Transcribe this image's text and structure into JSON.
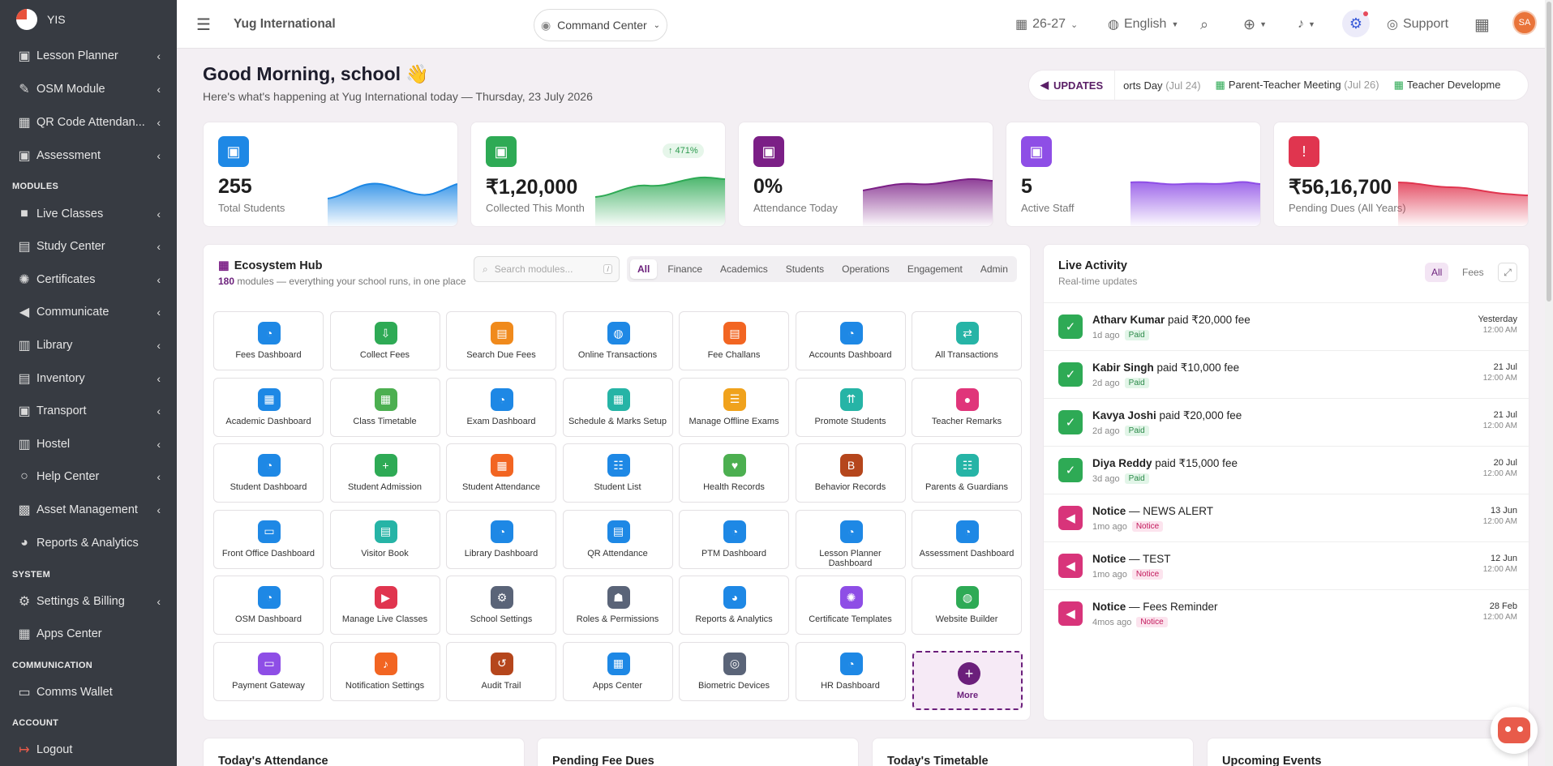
{
  "sidebar": {
    "brand": "YIS",
    "sections": {
      "modules": "MODULES",
      "system": "SYSTEM",
      "communication": "COMMUNICATION",
      "account": "ACCOUNT"
    },
    "items": [
      {
        "label": "Lesson Planner",
        "icon": "clipboard-icon"
      },
      {
        "label": "OSM Module",
        "icon": "pen-icon"
      },
      {
        "label": "QR Code Attendan...",
        "icon": "qr-icon"
      },
      {
        "label": "Assessment",
        "icon": "clipboard-check-icon"
      },
      {
        "label": "Live Classes",
        "icon": "video-icon"
      },
      {
        "label": "Study Center",
        "icon": "book-user-icon"
      },
      {
        "label": "Certificates",
        "icon": "badge-icon"
      },
      {
        "label": "Communicate",
        "icon": "megaphone-icon"
      },
      {
        "label": "Library",
        "icon": "book-icon"
      },
      {
        "label": "Inventory",
        "icon": "warehouse-icon"
      },
      {
        "label": "Transport",
        "icon": "bus-icon"
      },
      {
        "label": "Hostel",
        "icon": "building-icon"
      },
      {
        "label": "Help Center",
        "icon": "help-circle-icon"
      },
      {
        "label": "Asset Management",
        "icon": "cubes-icon"
      },
      {
        "label": "Reports & Analytics",
        "icon": "pie-chart-icon"
      },
      {
        "label": "Settings & Billing",
        "icon": "gears-icon"
      },
      {
        "label": "Apps Center",
        "icon": "grid-icon"
      },
      {
        "label": "Comms Wallet",
        "icon": "wallet-icon"
      },
      {
        "label": "Logout",
        "icon": "logout-icon"
      }
    ]
  },
  "topbar": {
    "school_name": "Yug International",
    "command_center": "Command Center",
    "session": "26-27",
    "language": "English",
    "support": "Support",
    "avatar_initials": "SA"
  },
  "greeting": {
    "title": "Good Morning, school 👋",
    "subtitle": "Here's what's happening at Yug International today — Thursday, 23 July 2026"
  },
  "updates": {
    "label": "UPDATES",
    "items": [
      {
        "text": "orts Day",
        "date": "(Jul 24)"
      },
      {
        "text": "Parent-Teacher Meeting",
        "date": "(Jul 26)"
      },
      {
        "text": "Teacher Developme",
        "date": ""
      }
    ]
  },
  "kpis": [
    {
      "value": "255",
      "label": "Total Students",
      "color": "#1e88e5",
      "icon": "student-icon"
    },
    {
      "value": "₹1,20,000",
      "label": "Collected This Month",
      "color": "#2eaa55",
      "icon": "cash-icon",
      "trend": "↑ 471%"
    },
    {
      "value": "0%",
      "label": "Attendance Today",
      "color": "#7b1f86",
      "icon": "attendance-icon"
    },
    {
      "value": "5",
      "label": "Active Staff",
      "color": "#8e4ee6",
      "icon": "staff-icon"
    },
    {
      "value": "₹56,16,700",
      "label": "Pending Dues (All Years)",
      "color": "#e0354f",
      "icon": "alert-icon"
    }
  ],
  "hub": {
    "title": "Ecosystem Hub",
    "count": "180",
    "subtitle": " modules — everything your school runs, in one place",
    "search_placeholder": "Search modules...",
    "search_key": "/",
    "tabs": [
      "All",
      "Finance",
      "Academics",
      "Students",
      "Operations",
      "Engagement",
      "Admin"
    ],
    "tiles": [
      {
        "label": "Fees Dashboard",
        "color": "#1e88e5",
        "glyph": "◔"
      },
      {
        "label": "Collect Fees",
        "color": "#2eaa55",
        "glyph": "⇩"
      },
      {
        "label": "Search Due Fees",
        "color": "#f08a1c",
        "glyph": "▤"
      },
      {
        "label": "Online Transactions",
        "color": "#1e88e5",
        "glyph": "◍"
      },
      {
        "label": "Fee Challans",
        "color": "#f26522",
        "glyph": "▤"
      },
      {
        "label": "Accounts Dashboard",
        "color": "#1e88e5",
        "glyph": "◔"
      },
      {
        "label": "All Transactions",
        "color": "#26b4a6",
        "glyph": "⇄"
      },
      {
        "label": "Academic Dashboard",
        "color": "#1e88e5",
        "glyph": "▦"
      },
      {
        "label": "Class Timetable",
        "color": "#4caf50",
        "glyph": "▦"
      },
      {
        "label": "Exam Dashboard",
        "color": "#1e88e5",
        "glyph": "◔"
      },
      {
        "label": "Schedule & Marks Setup",
        "color": "#26b4a6",
        "glyph": "▦"
      },
      {
        "label": "Manage Offline Exams",
        "color": "#f0a21c",
        "glyph": "☰"
      },
      {
        "label": "Promote Students",
        "color": "#26b4a6",
        "glyph": "⇈"
      },
      {
        "label": "Teacher Remarks",
        "color": "#e0357a",
        "glyph": "●"
      },
      {
        "label": "Student Dashboard",
        "color": "#1e88e5",
        "glyph": "◔"
      },
      {
        "label": "Student Admission",
        "color": "#2eaa55",
        "glyph": "+"
      },
      {
        "label": "Student Attendance",
        "color": "#f26522",
        "glyph": "▦"
      },
      {
        "label": "Student List",
        "color": "#1e88e5",
        "glyph": "☷"
      },
      {
        "label": "Health Records",
        "color": "#4caf50",
        "glyph": "♥"
      },
      {
        "label": "Behavior Records",
        "color": "#b5461c",
        "glyph": "B"
      },
      {
        "label": "Parents & Guardians",
        "color": "#26b4a6",
        "glyph": "☷"
      },
      {
        "label": "Front Office Dashboard",
        "color": "#1e88e5",
        "glyph": "▭"
      },
      {
        "label": "Visitor Book",
        "color": "#26b4a6",
        "glyph": "▤"
      },
      {
        "label": "Library Dashboard",
        "color": "#1e88e5",
        "glyph": "◔"
      },
      {
        "label": "QR Attendance",
        "color": "#1e88e5",
        "glyph": "▤"
      },
      {
        "label": "PTM Dashboard",
        "color": "#1e88e5",
        "glyph": "◔"
      },
      {
        "label": "Lesson Planner Dashboard",
        "color": "#1e88e5",
        "glyph": "◔"
      },
      {
        "label": "Assessment Dashboard",
        "color": "#1e88e5",
        "glyph": "◔"
      },
      {
        "label": "OSM Dashboard",
        "color": "#1e88e5",
        "glyph": "◔"
      },
      {
        "label": "Manage Live Classes",
        "color": "#e0354f",
        "glyph": "▶"
      },
      {
        "label": "School Settings",
        "color": "#5a6478",
        "glyph": "⚙"
      },
      {
        "label": "Roles & Permissions",
        "color": "#5a6478",
        "glyph": "☗"
      },
      {
        "label": "Reports & Analytics",
        "color": "#1e88e5",
        "glyph": "◕"
      },
      {
        "label": "Certificate Templates",
        "color": "#8e4ee6",
        "glyph": "✺"
      },
      {
        "label": "Website Builder",
        "color": "#2eaa55",
        "glyph": "◍"
      },
      {
        "label": "Payment Gateway",
        "color": "#8e4ee6",
        "glyph": "▭"
      },
      {
        "label": "Notification Settings",
        "color": "#f26522",
        "glyph": "♪"
      },
      {
        "label": "Audit Trail",
        "color": "#b5461c",
        "glyph": "↺"
      },
      {
        "label": "Apps Center",
        "color": "#1e88e5",
        "glyph": "▦"
      },
      {
        "label": "Biometric Devices",
        "color": "#5a6478",
        "glyph": "◎"
      },
      {
        "label": "HR Dashboard",
        "color": "#1e88e5",
        "glyph": "◔"
      }
    ],
    "more_label": "More"
  },
  "live_activity": {
    "title": "Live Activity",
    "subtitle": "Real-time updates",
    "tabs": [
      "All",
      "Fees"
    ],
    "items": [
      {
        "name": "Atharv Kumar",
        "text": " paid ₹20,000 fee",
        "ago": "1d ago",
        "badge": "Paid",
        "date": "Yesterday",
        "time": "12:00 AM",
        "type": "paid"
      },
      {
        "name": "Kabir Singh",
        "text": " paid ₹10,000 fee",
        "ago": "2d ago",
        "badge": "Paid",
        "date": "21 Jul",
        "time": "12:00 AM",
        "type": "paid"
      },
      {
        "name": "Kavya Joshi",
        "text": " paid ₹20,000 fee",
        "ago": "2d ago",
        "badge": "Paid",
        "date": "21 Jul",
        "time": "12:00 AM",
        "type": "paid"
      },
      {
        "name": "Diya Reddy",
        "text": " paid ₹15,000 fee",
        "ago": "3d ago",
        "badge": "Paid",
        "date": "20 Jul",
        "time": "12:00 AM",
        "type": "paid"
      },
      {
        "name": "Notice",
        "text": " — NEWS ALERT",
        "ago": "1mo ago",
        "badge": "Notice",
        "date": "13 Jun",
        "time": "12:00 AM",
        "type": "notice"
      },
      {
        "name": "Notice",
        "text": " — TEST",
        "ago": "1mo ago",
        "badge": "Notice",
        "date": "12 Jun",
        "time": "12:00 AM",
        "type": "notice"
      },
      {
        "name": "Notice",
        "text": " — Fees Reminder",
        "ago": "4mos ago",
        "badge": "Notice",
        "date": "28 Feb",
        "time": "12:00 AM",
        "type": "notice"
      }
    ]
  },
  "bottom_cards": [
    "Today's Attendance",
    "Pending Fee Dues",
    "Today's Timetable",
    "Upcoming Events"
  ]
}
